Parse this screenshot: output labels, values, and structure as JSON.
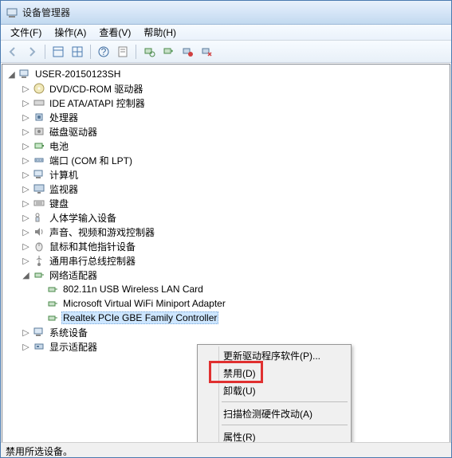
{
  "window": {
    "title": "设备管理器"
  },
  "menu": {
    "file": "文件(F)",
    "action": "操作(A)",
    "view": "查看(V)",
    "help": "帮助(H)"
  },
  "tree": {
    "root": "USER-20150123SH",
    "nodes": {
      "dvd": "DVD/CD-ROM 驱动器",
      "ide": "IDE ATA/ATAPI 控制器",
      "cpu": "处理器",
      "disk": "磁盘驱动器",
      "battery": "电池",
      "ports": "端口 (COM 和 LPT)",
      "computer": "计算机",
      "monitor": "监视器",
      "keyboard": "键盘",
      "hid": "人体学输入设备",
      "sound": "声音、视频和游戏控制器",
      "mouse": "鼠标和其他指针设备",
      "usb": "通用串行总线控制器",
      "network": "网络适配器",
      "system": "系统设备",
      "display": "显示适配器"
    },
    "network_children": {
      "n1": "802.11n USB Wireless LAN Card",
      "n2": "Microsoft Virtual WiFi Miniport Adapter",
      "n3": "Realtek PCIe GBE Family Controller"
    }
  },
  "context_menu": {
    "update": "更新驱动程序软件(P)...",
    "disable": "禁用(D)",
    "uninstall": "卸载(U)",
    "scan": "扫描检测硬件改动(A)",
    "properties": "属性(R)"
  },
  "status": "禁用所选设备。"
}
